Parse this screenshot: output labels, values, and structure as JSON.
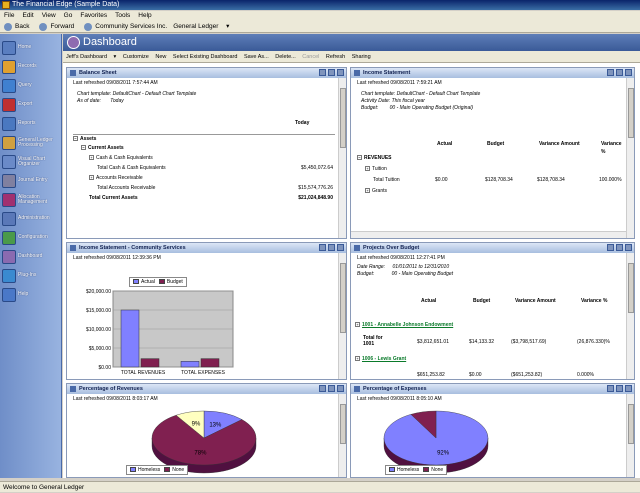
{
  "window": {
    "title": "The Financial Edge (Sample Data)"
  },
  "menu": [
    "File",
    "Edit",
    "View",
    "Go",
    "Favorites",
    "Tools",
    "Help"
  ],
  "nav": {
    "back": "Back",
    "forward": "Forward",
    "org": "Community Services Inc.",
    "section": "General Ledger"
  },
  "sidebar": {
    "items": [
      {
        "label": "Home",
        "color": "#5a7ec0"
      },
      {
        "label": "Records",
        "color": "#e0a030"
      },
      {
        "label": "Query",
        "color": "#4080d0"
      },
      {
        "label": "Export",
        "color": "#c03030"
      },
      {
        "label": "Reports",
        "color": "#4a78c0"
      },
      {
        "label": "General Ledger Processing",
        "color": "#d0a040"
      },
      {
        "label": "Visual Chart Organizer",
        "color": "#6a8ac8"
      },
      {
        "label": "Journal Entry",
        "color": "#8080a0"
      },
      {
        "label": "Allocation Management",
        "color": "#a03070"
      },
      {
        "label": "Administration",
        "color": "#5a78b8"
      },
      {
        "label": "Configuration",
        "color": "#4a9a4a"
      },
      {
        "label": "Dashboard",
        "color": "#8a6ab0"
      },
      {
        "label": "Plug-Ins",
        "color": "#3a8ad0"
      },
      {
        "label": "Help",
        "color": "#4a78c8"
      }
    ]
  },
  "dashboard": {
    "title": "Dashboard"
  },
  "toolbar": {
    "dashboard": "Jeff's Dashboard",
    "customize": "Customize",
    "new": "New",
    "select": "Select Existing Dashboard",
    "save_as": "Save As...",
    "delete": "Delete...",
    "cancel": "Cancel",
    "refresh": "Refresh",
    "sharing": "Sharing"
  },
  "balance_sheet": {
    "title": "Balance Sheet",
    "refreshed": "Last refreshed 09/08/2011 7:57:44 AM",
    "template_label": "Chart template:",
    "template": "DefaultChart - Default Chart Template",
    "asof_label": "As of date:",
    "asof": "Today",
    "col": "Today",
    "rows": [
      {
        "label": "Assets",
        "value": "",
        "indent": 0,
        "bold": true,
        "box": "minus"
      },
      {
        "label": "Current Assets",
        "value": "",
        "indent": 1,
        "bold": true,
        "box": "minus"
      },
      {
        "label": "Cash & Cash Equivalents",
        "value": "",
        "indent": 2,
        "bold": false,
        "box": "plus"
      },
      {
        "label": "Total Cash & Cash Equivalents",
        "value": "$5,450,072.64",
        "indent": 3,
        "bold": false,
        "box": ""
      },
      {
        "label": "Accounts Receivable",
        "value": "",
        "indent": 2,
        "bold": false,
        "box": "plus"
      },
      {
        "label": "Total Accounts Receivable",
        "value": "$15,574,776.26",
        "indent": 3,
        "bold": false,
        "box": ""
      },
      {
        "label": "Total Current Assets",
        "value": "$21,024,848.90",
        "indent": 2,
        "bold": true,
        "box": ""
      }
    ]
  },
  "income_statement": {
    "title": "Income Statement",
    "refreshed": "Last refreshed 09/08/2011 7:59:21 AM",
    "template_label": "Chart template:",
    "template": "DefaultChart - Default Chart Template",
    "activity_label": "Activity Date:",
    "activity": "This fiscal year",
    "budget_label": "Budget:",
    "budget": "00 - Main Operating Budget (Original)",
    "cols": [
      "Actual",
      "Budget",
      "Variance Amount",
      "Variance %"
    ],
    "rows": [
      {
        "label": "REVENUES",
        "box": "minus",
        "bold": true,
        "vals": [
          "",
          "",
          "",
          ""
        ]
      },
      {
        "label": "Tuition",
        "box": "plus",
        "bold": false,
        "vals": [
          "",
          "",
          "",
          ""
        ]
      },
      {
        "label": "Total Tuition",
        "box": "",
        "bold": false,
        "vals": [
          "$0.00",
          "$128,708.34",
          "$128,708.34",
          "100.000%"
        ]
      },
      {
        "label": "Grants",
        "box": "plus",
        "bold": false,
        "vals": [
          "",
          "",
          "",
          ""
        ]
      }
    ]
  },
  "income_community": {
    "title": "Income Statement - Community Services",
    "refreshed": "Last refreshed 09/08/2011 12:39:36 PM",
    "chart_data": {
      "type": "bar",
      "categories": [
        "TOTAL REVENUES",
        "TOTAL EXPENSES"
      ],
      "series": [
        {
          "name": "Actual",
          "values": [
            15000,
            1500
          ],
          "color": "#8080ff"
        },
        {
          "name": "Budget",
          "values": [
            2200,
            2200
          ],
          "color": "#802050"
        }
      ],
      "yticks": [
        "$20,000.00",
        "$15,000.00",
        "$10,000.00",
        "$5,000.00",
        "$0.00"
      ],
      "ylim": [
        0,
        20000
      ]
    }
  },
  "projects": {
    "title": "Projects Over Budget",
    "refreshed": "Last refreshed 09/08/2011 12:27:41 PM",
    "range_label": "Date Range:",
    "range": "01/01/2011 to 12/31/2010",
    "budget_label": "Budget:",
    "budget": "00 - Main Operating Budget",
    "cols": [
      "Actual",
      "Budget",
      "Variance Amount",
      "Variance %"
    ],
    "p1": {
      "name": "1001 - Annabelle Johnson Endowment",
      "total": "Total for 1001",
      "vals": [
        "$3,812,651.01",
        "$14,133.32",
        "($3,798,517.69)",
        "(26,876.330)%"
      ]
    },
    "p2": {
      "name": "1006 - Lewis Grant",
      "vals": [
        "$651,253.82",
        "$0.00",
        "($651,253.82)",
        "0.000%"
      ]
    }
  },
  "pct_revenues": {
    "title": "Percentage of Revenues",
    "refreshed": "Last refreshed 09/08/2011 8:03:17 AM",
    "chart_data": {
      "type": "pie",
      "slices": [
        {
          "label": "13%",
          "value": 13,
          "color": "#8080ff"
        },
        {
          "label": "78%",
          "value": 78,
          "color": "#802050"
        },
        {
          "label": "9%",
          "value": 9,
          "color": "#ffffc0"
        }
      ],
      "legend": [
        {
          "name": "Homeless",
          "color": "#8080ff"
        },
        {
          "name": "None",
          "color": "#802050"
        }
      ]
    }
  },
  "pct_expenses": {
    "title": "Percentage of Expenses",
    "refreshed": "Last refreshed 09/08/2011 8:05:10 AM",
    "chart_data": {
      "type": "pie",
      "slices": [
        {
          "label": "92%",
          "value": 92,
          "color": "#8080ff"
        },
        {
          "label": "",
          "value": 8,
          "color": "#802050"
        }
      ],
      "legend": [
        {
          "name": "Homeless",
          "color": "#8080ff"
        },
        {
          "name": "None",
          "color": "#802050"
        }
      ]
    }
  },
  "status": {
    "text": "Welcome to General Ledger"
  }
}
